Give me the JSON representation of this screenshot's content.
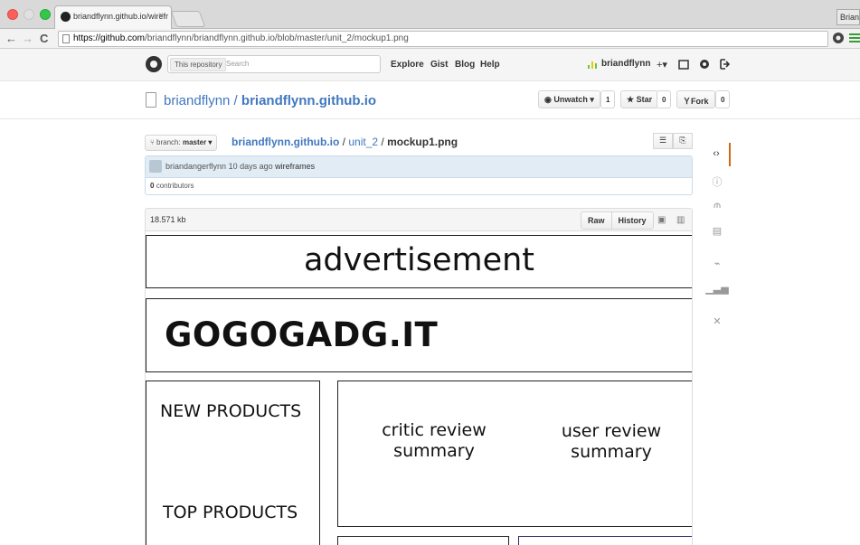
{
  "browser": {
    "tab_title": "briandflynn.github.io/wirefr",
    "tab_close": "×",
    "profile_name": "Brian",
    "back": "←",
    "forward": "→",
    "reload": "C",
    "url_host": "https://github.com",
    "url_path": "/briandflynn/briandflynn.github.io/blob/master/unit_2/mockup1.png"
  },
  "header": {
    "search_scope": "This repository",
    "search_placeholder": "Search",
    "nav": [
      "Explore",
      "Gist",
      "Blog",
      "Help"
    ],
    "username": "briandflynn",
    "plus": "+▾"
  },
  "repo": {
    "owner": "briandflynn",
    "separator": " / ",
    "name": "briandflynn.github.io",
    "unwatch_label": "Unwatch ▾",
    "watch_count": "1",
    "star_label": "Star",
    "star_count": "0",
    "fork_label": "Fork",
    "fork_count": "0"
  },
  "file_nav": {
    "branch_prefix": "branch:",
    "branch_name": "master ▾",
    "crumb_repo": "briandflynn.github.io",
    "crumb_sep1": " / ",
    "crumb_dir": "unit_2",
    "crumb_sep2": " / ",
    "crumb_file": "mockup1.png"
  },
  "commit": {
    "author": "briandangerflynn",
    "when": "10 days ago",
    "message": "wireframes",
    "contributors_count": "0",
    "contributors_label": "contributors"
  },
  "file": {
    "size": "18.571 kb",
    "raw_label": "Raw",
    "history_label": "History"
  },
  "mockup": {
    "advertisement": "advertisement",
    "brand": "GOGOGADG.IT",
    "new_products": "NEW PRODUCTS",
    "top_products": "TOP PRODUCTS",
    "critic_review_1": "critic review",
    "critic_review_2": "summary",
    "user_review_1": "user review",
    "user_review_2": "summary"
  }
}
